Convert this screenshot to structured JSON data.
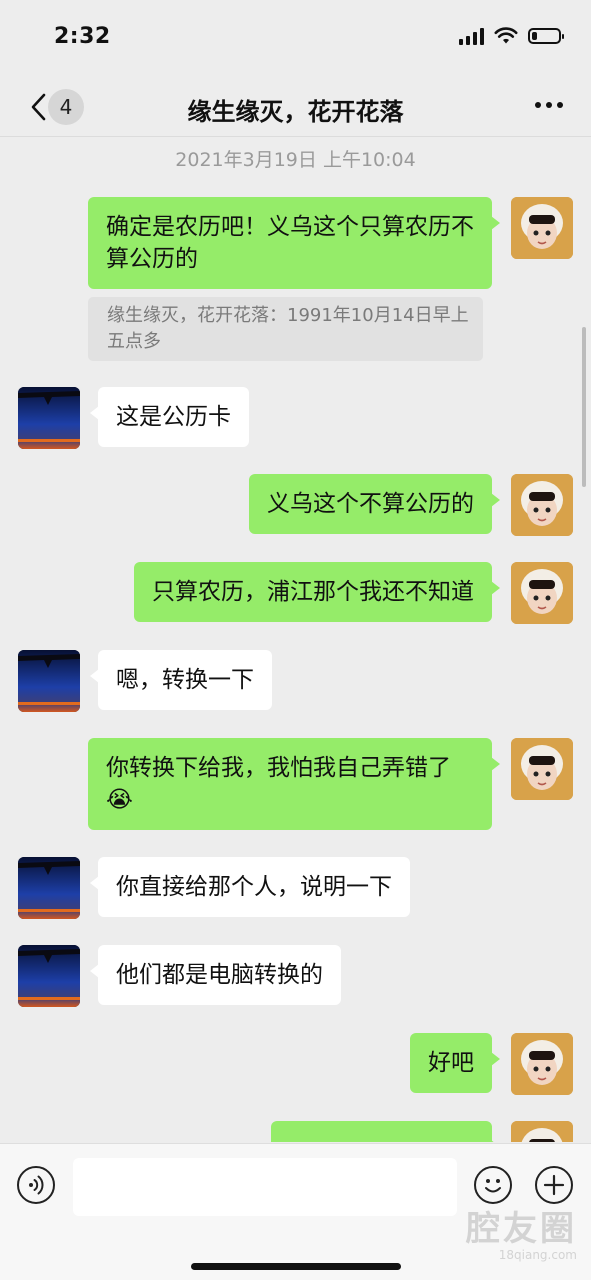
{
  "status_bar": {
    "time": "2:32"
  },
  "header": {
    "back_count": "4",
    "title": "缘生缘灭，花开花落"
  },
  "chat": {
    "timestamp": "2021年3月19日 上午10:04",
    "messages": [
      {
        "from": "me",
        "text": "确定是农历吧！义乌这个只算农历不算公历的"
      },
      {
        "from": "quote",
        "text": "缘生缘灭，花开花落：1991年10月14日早上五点多"
      },
      {
        "from": "other",
        "text": "这是公历卡"
      },
      {
        "from": "me",
        "text": "义乌这个不算公历的"
      },
      {
        "from": "me",
        "text": "只算农历，浦江那个我还不知道"
      },
      {
        "from": "other",
        "text": "嗯，转换一下"
      },
      {
        "from": "me",
        "text": "你转换下给我，我怕我自己弄错了",
        "emoji": "😭"
      },
      {
        "from": "other",
        "text": "你直接给那个人，说明一下"
      },
      {
        "from": "other",
        "text": "他们都是电脑转换的"
      },
      {
        "from": "me",
        "text": "好吧"
      }
    ]
  },
  "input_bar": {
    "value": ""
  },
  "watermark": {
    "main": "腔友圈",
    "sub": "18qiang.com"
  },
  "colors": {
    "outgoing_bubble": "#95ec69",
    "incoming_bubble": "#ffffff",
    "background": "#ededed"
  }
}
